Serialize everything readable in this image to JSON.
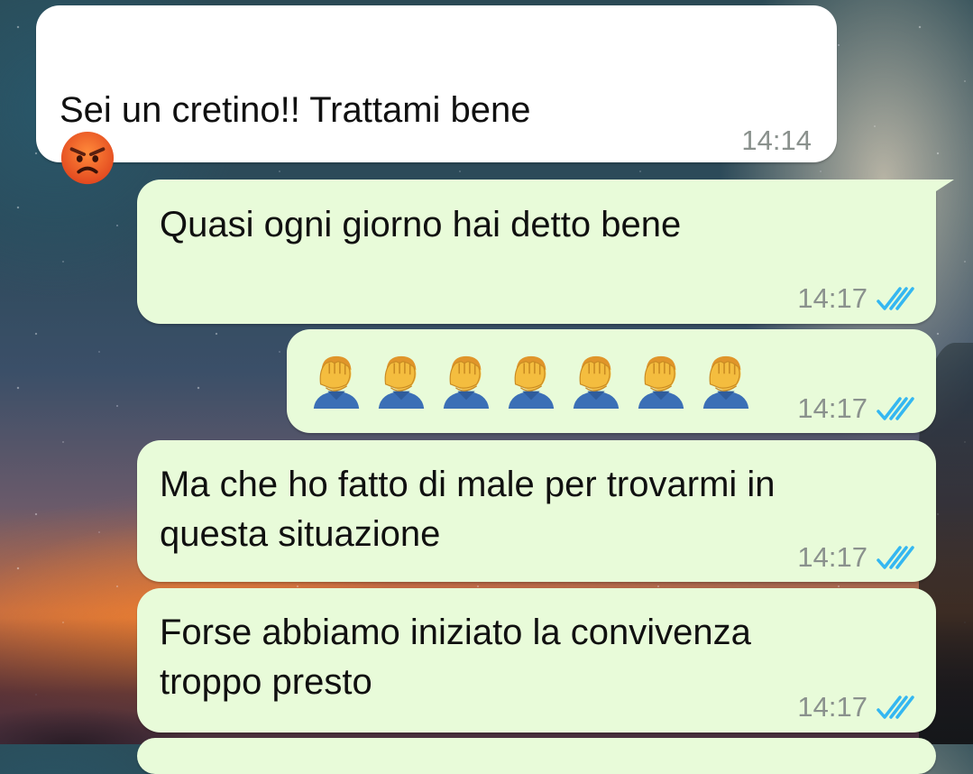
{
  "chat": {
    "messages": [
      {
        "id": "m1",
        "direction": "incoming",
        "text": "Sei un cretino!! Trattami bene",
        "emoji": "angry-face-emoji",
        "time": "14:14"
      },
      {
        "id": "m2",
        "direction": "outgoing",
        "text": "Quasi ogni giorno hai detto bene",
        "time": "14:17",
        "status": "read"
      },
      {
        "id": "m3",
        "direction": "outgoing",
        "emoji_repeat": {
          "emoji": "man-facepalming-emoji",
          "count": 7
        },
        "time": "14:17",
        "status": "read"
      },
      {
        "id": "m4",
        "direction": "outgoing",
        "text": "Ma che ho fatto di male per trovarmi in\nquesta situazione",
        "time": "14:17",
        "status": "read"
      },
      {
        "id": "m5",
        "direction": "outgoing",
        "text": "Forse abbiamo iniziato la convivenza\ntroppo presto",
        "time": "14:17",
        "status": "read"
      }
    ]
  },
  "colors": {
    "incoming_bubble": "#ffffff",
    "outgoing_bubble": "#e8fbd9",
    "timestamp": "#8a918d",
    "read_ticks": "#34b7f1"
  },
  "icons": {
    "read_receipt": "double-check-icon"
  }
}
